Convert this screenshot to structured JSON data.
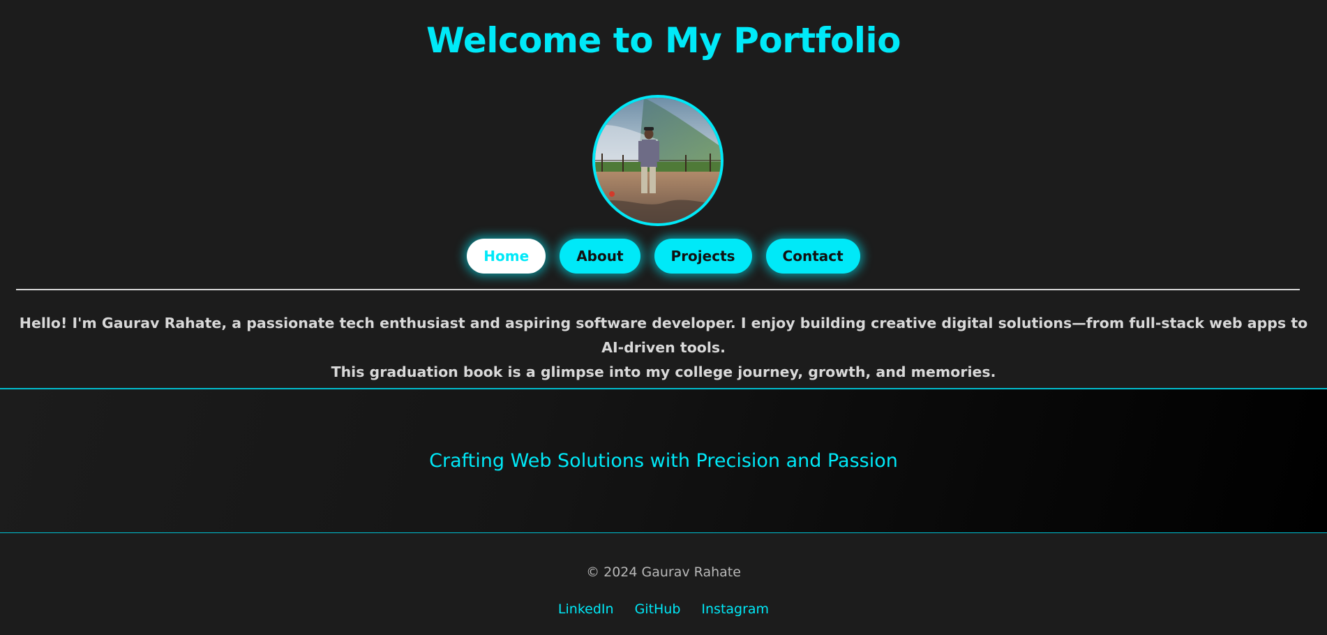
{
  "header": {
    "title": "Welcome to My Portfolio"
  },
  "nav": {
    "items": [
      {
        "label": "Home",
        "active": true
      },
      {
        "label": "About",
        "active": false
      },
      {
        "label": "Projects",
        "active": false
      },
      {
        "label": "Contact",
        "active": false
      }
    ]
  },
  "intro": {
    "line1": "Hello! I'm Gaurav Rahate, a passionate tech enthusiast and aspiring software developer. I enjoy building creative digital solutions—from full-stack web apps to AI-driven tools.",
    "line2": "This graduation book is a glimpse into my college journey, growth, and memories."
  },
  "hero": {
    "tagline": "Crafting Web Solutions with Precision and Passion"
  },
  "footer": {
    "copyright": "© 2024 Gaurav Rahate",
    "links": [
      {
        "label": "LinkedIn"
      },
      {
        "label": "GitHub"
      },
      {
        "label": "Instagram"
      }
    ]
  },
  "colors": {
    "accent": "#00e9f8",
    "background": "#1c1c1c",
    "text": "#d9d9d9",
    "active_button_bg": "#ffffff"
  }
}
